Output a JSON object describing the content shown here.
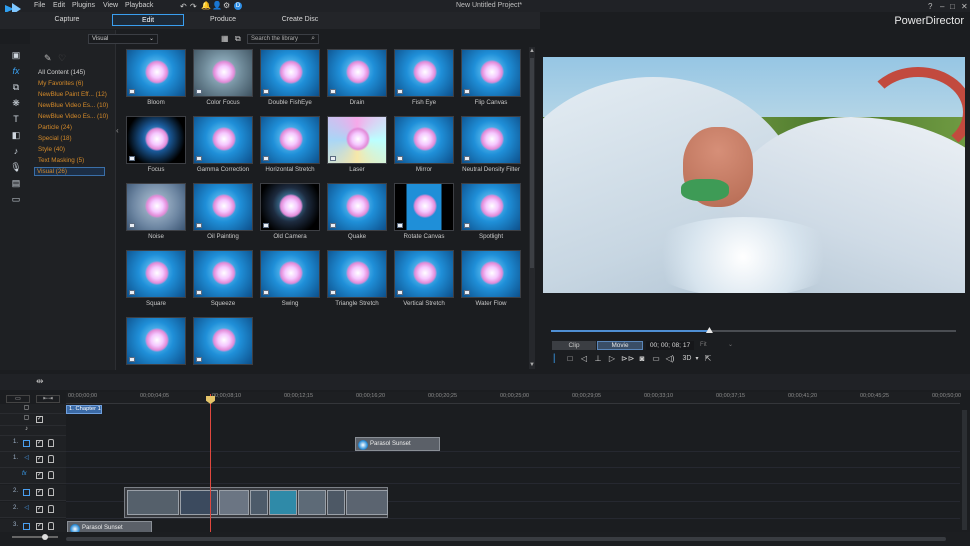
{
  "app": {
    "title": "New Untitled Project*",
    "brand": "PowerDirector"
  },
  "menu": [
    "File",
    "Edit",
    "Plugins",
    "View",
    "Playback"
  ],
  "window_icons": [
    "?",
    "–",
    "□",
    "✕"
  ],
  "modes": {
    "capture": "Capture",
    "edit": "Edit",
    "produce": "Produce",
    "create_disc": "Create Disc"
  },
  "library": {
    "dropdown": "Visual",
    "search_placeholder": "Search the library"
  },
  "categories": [
    {
      "label": "All Content (145)"
    },
    {
      "label": "My Favorites (6)"
    },
    {
      "label": "NewBlue Paint Eff... (12)"
    },
    {
      "label": "NewBlue Video Es... (10)"
    },
    {
      "label": "NewBlue Video Es... (10)"
    },
    {
      "label": "Particle (24)"
    },
    {
      "label": "Special (18)"
    },
    {
      "label": "Style (40)"
    },
    {
      "label": "Text Masking (5)"
    },
    {
      "label": "Visual (26)"
    }
  ],
  "effects": [
    "Bloom",
    "Color Focus",
    "Double FishEye",
    "Drain",
    "Fish Eye",
    "Flip Canvas",
    "Focus",
    "Gamma Correction",
    "Horizontal Stretch",
    "Laser",
    "Mirror",
    "Neutral Density Filter",
    "Noise",
    "Oil Painting",
    "Old Camera",
    "Quake",
    "Rotate Canvas",
    "Spotlight",
    "Square",
    "Squeeze",
    "Swing",
    "Triangle Stretch",
    "Vertical Stretch",
    "Water Flow",
    "",
    ""
  ],
  "preview": {
    "clip_tab": "Clip",
    "movie_tab": "Movie",
    "timecode": "00; 00; 08; 17",
    "fit": "Fit",
    "mode3d": "3D",
    "progress": 0.39
  },
  "timeline": {
    "ruler": [
      "00;00;00;00",
      "00;00;04;05",
      "00;00;08;10",
      "00;00;12;15",
      "00;00;16;20",
      "00;00;20;25",
      "00;00;25;00",
      "00;00;29;05",
      "00;00;33;10",
      "00;00;37;15",
      "00;00;41;20",
      "00;00;45;25",
      "00;00;50;00"
    ],
    "chapter": "1. Chapter 1",
    "tracks": {
      "t1v": "1.",
      "t1a": "1.",
      "fx": "fx",
      "t2v": "2.",
      "t2a": "2.",
      "t3": "3."
    },
    "clips": {
      "overlay": "Parasol Sunset",
      "bottom": "Parasol Sunset"
    }
  },
  "icons": [
    "photo-icon",
    "fx-icon",
    "pip-icon",
    "particle-icon",
    "title-icon",
    "transition-icon",
    "audio-icon",
    "chapter-icon",
    "subtitle-icon",
    "keyframe-icon"
  ]
}
